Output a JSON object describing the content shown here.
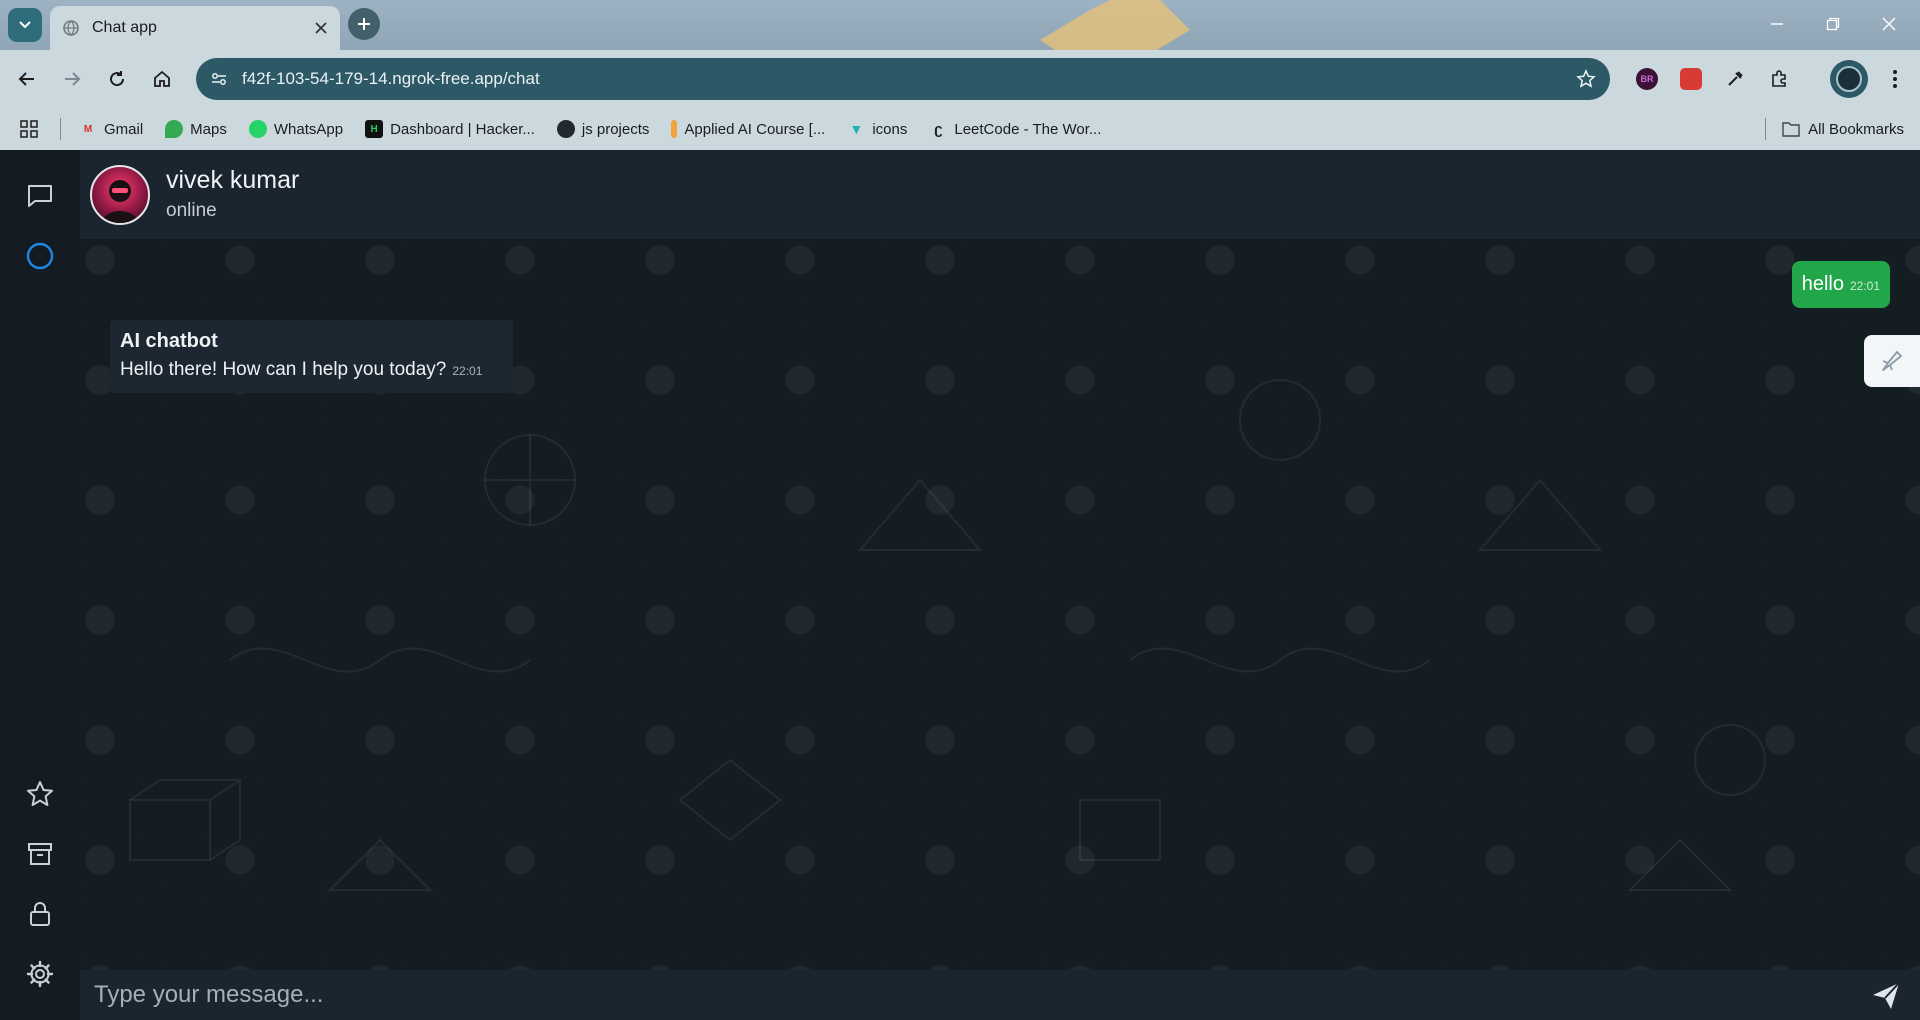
{
  "browser": {
    "tab_title": "Chat app",
    "url": "f42f-103-54-179-14.ngrok-free.app/chat",
    "bookmarks": [
      {
        "label": "Gmail",
        "icon": "gmail-icon"
      },
      {
        "label": "Maps",
        "icon": "maps-icon"
      },
      {
        "label": "WhatsApp",
        "icon": "whatsapp-icon"
      },
      {
        "label": "Dashboard | Hacker...",
        "icon": "hackerrank-icon"
      },
      {
        "label": "js projects",
        "icon": "github-icon"
      },
      {
        "label": "Applied AI Course [...",
        "icon": "appliedai-icon"
      },
      {
        "label": "icons",
        "icon": "vue-icon"
      },
      {
        "label": "LeetCode - The Wor...",
        "icon": "leetcode-icon"
      }
    ],
    "all_bookmarks": "All Bookmarks",
    "extension_initials": "BR"
  },
  "chat": {
    "contact_name": "vivek kumar",
    "contact_status": "online",
    "messages": {
      "outgoing": {
        "text": "hello",
        "time": "22:01"
      },
      "incoming": {
        "sender": "AI chatbot",
        "text": "Hello there! How can I help you today?",
        "time": "22:01"
      }
    },
    "input_placeholder": "Type your message..."
  },
  "colors": {
    "outgoing_bubble": "#22a64a",
    "incoming_bubble": "#1c2731",
    "sidebar_accent": "#1e88e5"
  }
}
